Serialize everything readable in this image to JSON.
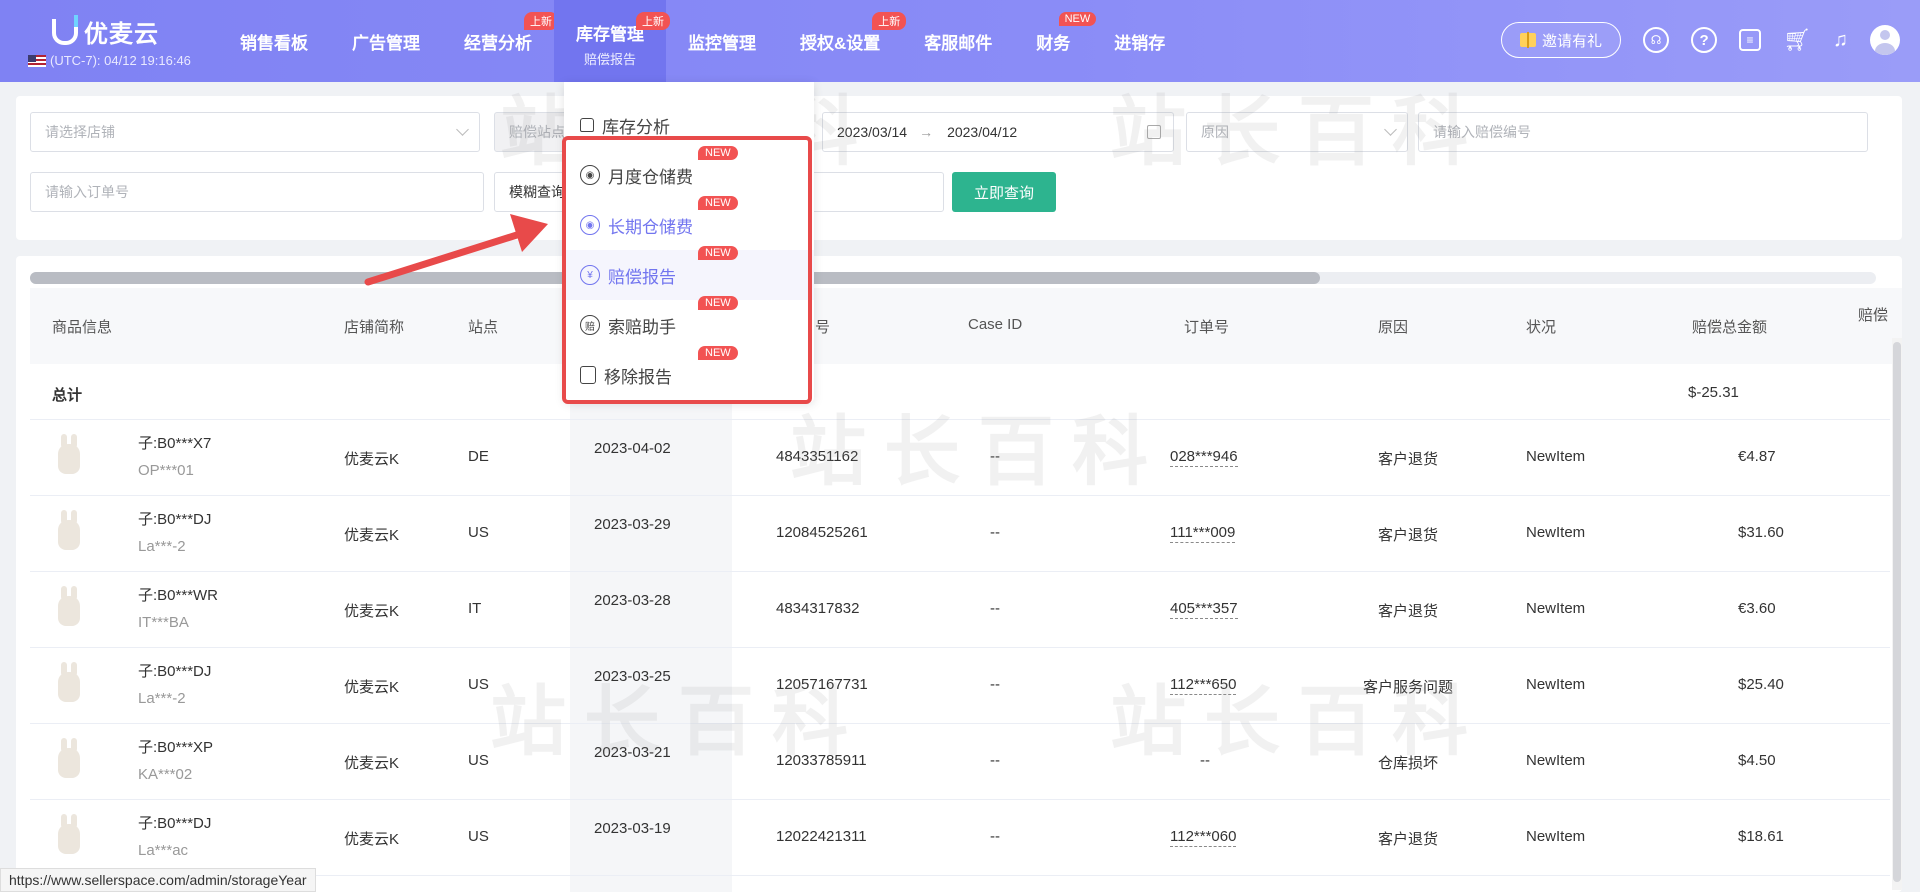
{
  "brand": {
    "name": "优麦云",
    "timezone": "(UTC-7): 04/12 19:16:46"
  },
  "nav": {
    "items": [
      {
        "label": "销售看板",
        "badge": ""
      },
      {
        "label": "广告管理",
        "badge": ""
      },
      {
        "label": "经营分析",
        "badge": "上新"
      },
      {
        "label": "库存管理",
        "badge": "上新",
        "sub": "赔偿报告"
      },
      {
        "label": "监控管理",
        "badge": ""
      },
      {
        "label": "授权&设置",
        "badge": "上新"
      },
      {
        "label": "客服邮件",
        "badge": ""
      },
      {
        "label": "财务",
        "badge": "NEW"
      },
      {
        "label": "进销存",
        "badge": ""
      }
    ],
    "invite_label": "邀请有礼"
  },
  "filters": {
    "store_placeholder": "请选择店铺",
    "site_placeholder": "赔偿站点",
    "date_start": "2023/03/14",
    "date_sep": "→",
    "date_end": "2023/04/12",
    "reason_placeholder": "原因",
    "comp_id_placeholder": "请输入赔偿编号",
    "order_placeholder": "请输入订单号",
    "fuzzy_label": "模糊查询",
    "query_button": "立即查询"
  },
  "dropdown": {
    "items": [
      {
        "label": "库存分析",
        "new": ""
      },
      {
        "label": "月度仓储费",
        "new": "NEW"
      },
      {
        "label": "长期仓储费",
        "new": "NEW"
      },
      {
        "label": "赔偿报告",
        "new": "NEW"
      },
      {
        "label": "索赔助手",
        "new": "NEW"
      },
      {
        "label": "移除报告",
        "new": "NEW"
      }
    ]
  },
  "table": {
    "headers": [
      "商品信息",
      "店铺简称",
      "站点",
      "编号",
      "Case ID",
      "订单号",
      "原因",
      "状况",
      "赔偿总金额",
      "赔偿"
    ],
    "total_label": "总计",
    "total_amount": "$-25.31",
    "rows": [
      {
        "asin": "子:B0***X7",
        "sku": "OP***01",
        "store": "优麦云K",
        "site": "DE",
        "date": "2023-04-02",
        "id": "4843351162",
        "case": "--",
        "order": "028***946",
        "reason": "客户退货",
        "status": "NewItem",
        "amount": "€4.87"
      },
      {
        "asin": "子:B0***DJ",
        "sku": "La***-2",
        "store": "优麦云K",
        "site": "US",
        "date": "2023-03-29",
        "id": "12084525261",
        "case": "--",
        "order": "111***009",
        "reason": "客户退货",
        "status": "NewItem",
        "amount": "$31.60"
      },
      {
        "asin": "子:B0***WR",
        "sku": "IT***BA",
        "store": "优麦云K",
        "site": "IT",
        "date": "2023-03-28",
        "id": "4834317832",
        "case": "--",
        "order": "405***357",
        "reason": "客户退货",
        "status": "NewItem",
        "amount": "€3.60"
      },
      {
        "asin": "子:B0***DJ",
        "sku": "La***-2",
        "store": "优麦云K",
        "site": "US",
        "date": "2023-03-25",
        "id": "12057167731",
        "case": "--",
        "order": "112***650",
        "reason": "客户服务问题",
        "status": "NewItem",
        "amount": "$25.40"
      },
      {
        "asin": "子:B0***XP",
        "sku": "KA***02",
        "store": "优麦云K",
        "site": "US",
        "date": "2023-03-21",
        "id": "12033785911",
        "case": "--",
        "order": "--",
        "reason": "仓库损坏",
        "status": "NewItem",
        "amount": "$4.50"
      },
      {
        "asin": "子:B0***DJ",
        "sku": "La***ac",
        "store": "优麦云K",
        "site": "US",
        "date": "2023-03-19",
        "id": "12022421311",
        "case": "--",
        "order": "112***060",
        "reason": "客户退货",
        "status": "NewItem",
        "amount": "$18.61"
      }
    ]
  },
  "watermark": "站长百科",
  "statusbar_url": "https://www.sellerspace.com/admin/storageYear",
  "colors": {
    "nav": "#8386f5",
    "accent": "#7275ef",
    "query_button": "#2db48f",
    "badge": "#f25353",
    "highlight_box": "#e84a4a"
  }
}
